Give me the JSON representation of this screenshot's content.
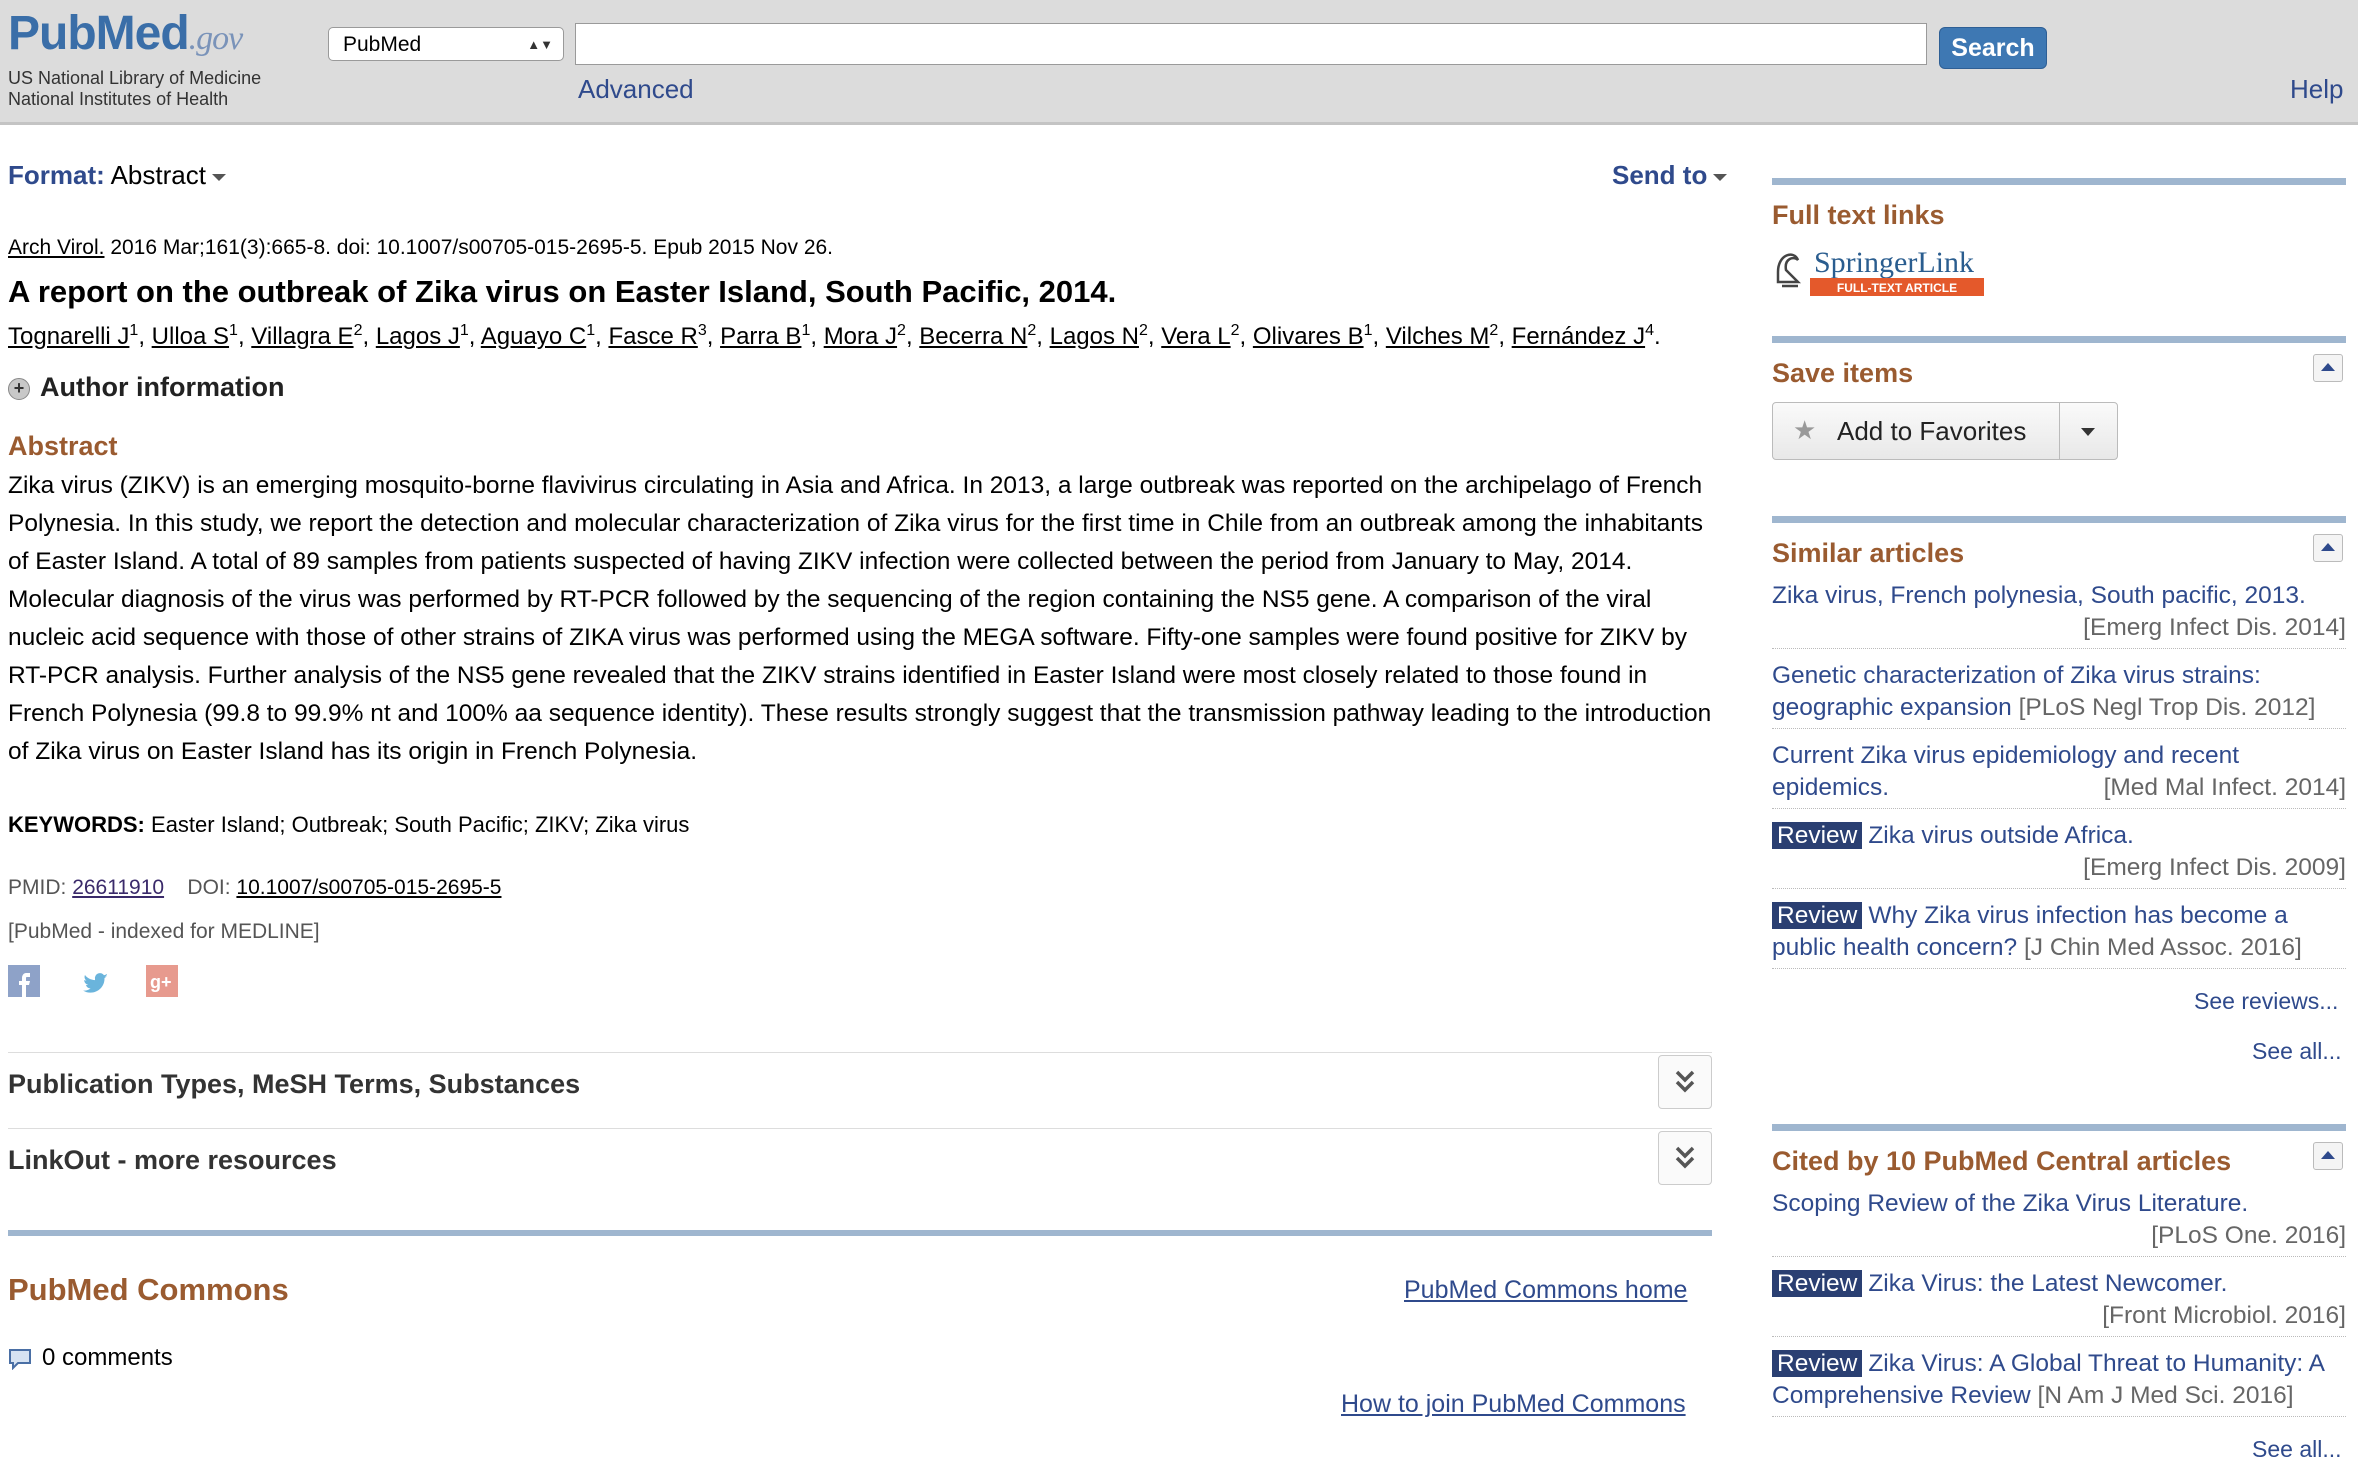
{
  "header": {
    "logo_pub": "Pub",
    "logo_med": "Med",
    "logo_gov": ".gov",
    "nlm_line1": "US National Library of Medicine",
    "nlm_line2": "National Institutes of Health",
    "db_selected": "PubMed",
    "search_value": "",
    "search_button": "Search",
    "advanced": "Advanced",
    "help": "Help"
  },
  "toolbar": {
    "format_label": "Format",
    "format_value": "Abstract",
    "send_to": "Send to"
  },
  "article": {
    "journal": "Arch Virol.",
    "citation_rest": "2016 Mar;161(3):665-8. doi: 10.1007/s00705-015-2695-5. Epub 2015 Nov 26.",
    "title": "A report on the outbreak of Zika virus on Easter Island, South Pacific, 2014.",
    "authors": [
      {
        "name": "Tognarelli J",
        "aff": "1"
      },
      {
        "name": "Ulloa S",
        "aff": "1"
      },
      {
        "name": "Villagra E",
        "aff": "2"
      },
      {
        "name": "Lagos J",
        "aff": "1"
      },
      {
        "name": "Aguayo C",
        "aff": "1"
      },
      {
        "name": "Fasce R",
        "aff": "3"
      },
      {
        "name": "Parra B",
        "aff": "1"
      },
      {
        "name": "Mora J",
        "aff": "2"
      },
      {
        "name": "Becerra N",
        "aff": "2"
      },
      {
        "name": "Lagos N",
        "aff": "2"
      },
      {
        "name": "Vera L",
        "aff": "2"
      },
      {
        "name": "Olivares B",
        "aff": "1"
      },
      {
        "name": "Vilches M",
        "aff": "2"
      },
      {
        "name": "Fernández J",
        "aff": "4"
      }
    ],
    "author_info": "Author information",
    "abstract_heading": "Abstract",
    "abstract": "Zika virus (ZIKV) is an emerging mosquito-borne flavivirus circulating in Asia and Africa. In 2013, a large outbreak was reported on the archipelago of French Polynesia. In this study, we report the detection and molecular characterization of Zika virus for the first time in Chile from an outbreak among the inhabitants of Easter Island. A total of 89 samples from patients suspected of having ZIKV infection were collected between the period from January to May, 2014. Molecular diagnosis of the virus was performed by RT-PCR followed by the sequencing of the region containing the NS5 gene. A comparison of the viral nucleic acid sequence with those of other strains of ZIKA virus was performed using the MEGA software. Fifty-one samples were found positive for ZIKV by RT-PCR analysis. Further analysis of the NS5 gene revealed that the ZIKV strains identified in Easter Island were most closely related to those found in French Polynesia (99.8 to 99.9% nt and 100% aa sequence identity). These results strongly suggest that the transmission pathway leading to the introduction of Zika virus on Easter Island has its origin in French Polynesia.",
    "keywords_label": "KEYWORDS:",
    "keywords": "Easter Island; Outbreak; South Pacific; ZIKV; Zika virus",
    "pmid_label": "PMID:",
    "pmid": "26611910",
    "doi_label": "DOI:",
    "doi": "10.1007/s00705-015-2695-5",
    "indexed": "[PubMed - indexed for MEDLINE]",
    "sections": [
      "Publication Types, MeSH Terms, Substances",
      "LinkOut - more resources"
    ]
  },
  "commons": {
    "heading": "PubMed Commons",
    "home_link": "PubMed Commons home",
    "comments": "0 comments",
    "join_link": "How to join PubMed Commons"
  },
  "sidebar": {
    "fulltext_heading": "Full text links",
    "springer_name": "SpringerLink",
    "springer_tag": "FULL-TEXT ARTICLE",
    "save_heading": "Save items",
    "add_favorites": "Add to Favorites",
    "similar_heading": "Similar articles",
    "similar": [
      {
        "title": "Zika virus, French polynesia, South pacific, 2013.",
        "source": "[Emerg Infect Dis. 2014]",
        "review": false
      },
      {
        "title": "Genetic characterization of Zika virus strains: geographic expansion",
        "source": "[PLoS Negl Trop Dis. 2012]",
        "review": false
      },
      {
        "title": "Current Zika virus epidemiology and recent epidemics.",
        "source": "[Med Mal Infect. 2014]",
        "review": false
      },
      {
        "title": "Zika virus outside Africa.",
        "source": "[Emerg Infect Dis. 2009]",
        "review": true
      },
      {
        "title": "Why Zika virus infection has become a public health concern?",
        "source": "[J Chin Med Assoc. 2016]",
        "review": true
      }
    ],
    "review_badge": "Review",
    "see_reviews": "See reviews...",
    "see_all": "See all...",
    "cited_heading": "Cited by 10 PubMed Central articles",
    "cited": [
      {
        "title": "Scoping Review of the Zika Virus Literature.",
        "source": "[PLoS One. 2016]",
        "review": false
      },
      {
        "title": "Zika Virus: the Latest Newcomer.",
        "source": "[Front Microbiol. 2016]",
        "review": true
      },
      {
        "title": "Zika Virus: A Global Threat to Humanity: A Comprehensive Review",
        "source": "[N Am J Med Sci. 2016]",
        "review": true
      }
    ],
    "cited_see_all": "See all..."
  }
}
